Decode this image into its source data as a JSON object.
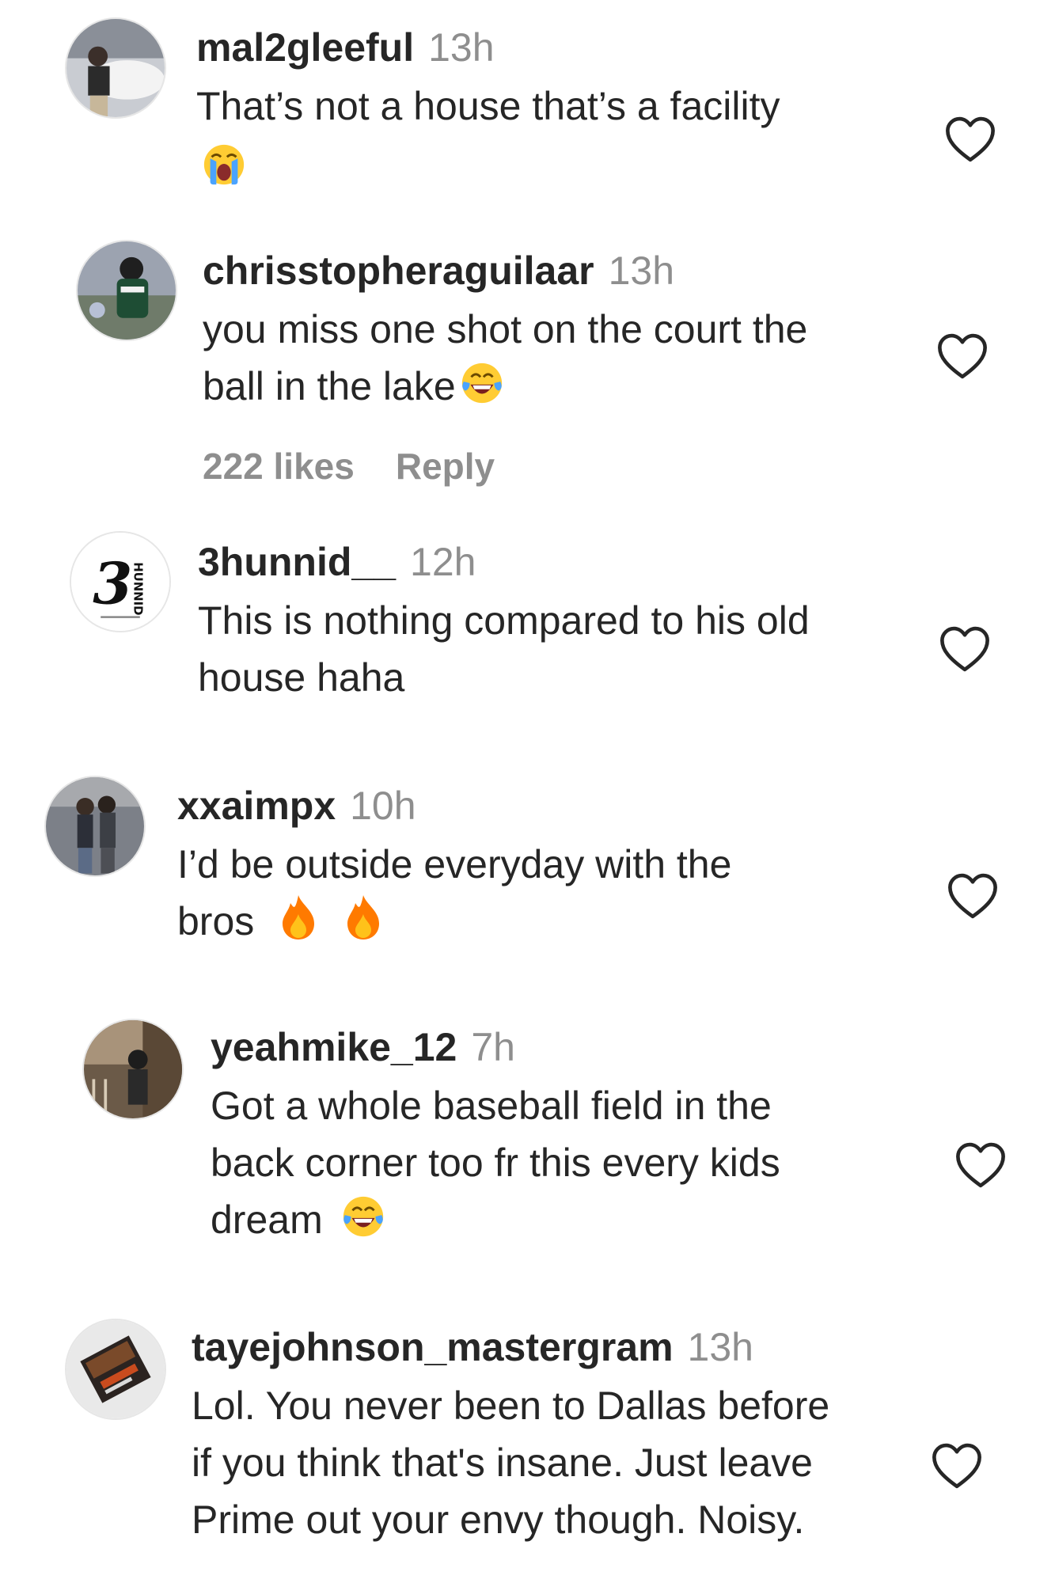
{
  "comments": [
    {
      "username": "mal2gleeful",
      "time": "13h",
      "lines": [
        "That’s not a house that’s a facility"
      ],
      "emoji": "loudly-crying-face"
    },
    {
      "username": "chrisstopheraguilaar",
      "time": "13h",
      "lines": [
        "you miss one shot on the court the",
        "ball in the lake"
      ],
      "emoji": "face-with-tears-of-joy",
      "likes": "222 likes",
      "reply": "Reply"
    },
    {
      "username": "3hunnid__",
      "time": "12h",
      "lines": [
        "This is nothing compared to his old",
        "house haha"
      ]
    },
    {
      "username": "xxaimpx",
      "time": "10h",
      "lines": [
        "I’d be outside everyday with the",
        "bros"
      ],
      "emoji": "fire fire"
    },
    {
      "username": "yeahmike_12",
      "time": "7h",
      "lines": [
        "Got a whole baseball field in the",
        "back corner too fr this every kids",
        "dream"
      ],
      "emoji": "face-with-tears-of-joy"
    },
    {
      "username": "tayejohnson_mastergram",
      "time": "13h",
      "lines": [
        "Lol. You never been to Dallas before",
        "if you think that's insane. Just leave",
        "Prime out your envy though. Noisy."
      ]
    }
  ],
  "avatars": {
    "logo_text": "3",
    "logo_side": "HUNNID"
  },
  "colors": {
    "text": "#262626",
    "muted": "#8e8e8e",
    "emoji_yellow": "#ffcc33",
    "fire_orange": "#ff7a00"
  }
}
